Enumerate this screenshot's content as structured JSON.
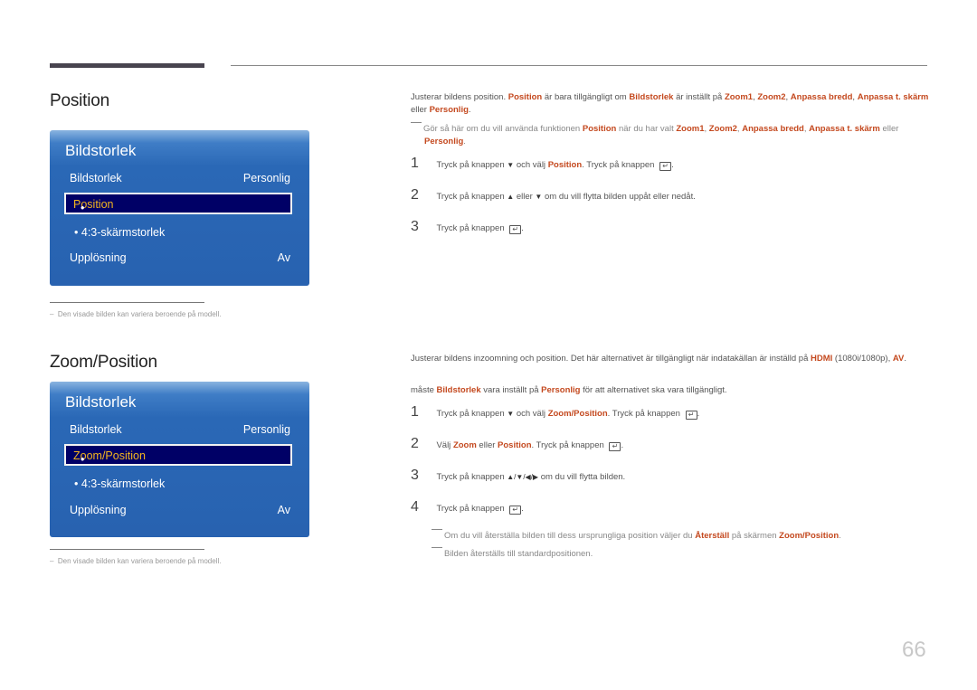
{
  "page_number": "66",
  "footnote": "Den visade bilden kan variera beroende på modell.",
  "section1": {
    "title": "Position",
    "menu": {
      "title": "Bildstorlek",
      "row1_label": "Bildstorlek",
      "row1_value": "Personlig",
      "selected_item": "Position",
      "sub_item": "4:3-skärmstorlek",
      "row3_label": "Upplösning",
      "row3_value": "Av",
      "bullet": "•"
    },
    "intro": {
      "t1": "Justerar bildens position. ",
      "h1": "Position",
      "t2": " är bara tillgängligt om ",
      "h2": "Bildstorlek",
      "t3": " är inställt på ",
      "h3": "Zoom1",
      "t4": ", ",
      "h4": "Zoom2",
      "t5": ", ",
      "h5": "Anpassa bredd",
      "t6": ", ",
      "h6": "Anpassa t. skärm",
      "t7": " eller ",
      "h7": "Personlig",
      "t8": "."
    },
    "note": {
      "t1": "Gör så här om du vill använda funktionen ",
      "h1": "Position",
      "t2": " när du har valt ",
      "h2": "Zoom1",
      "t3": ", ",
      "h3": "Zoom2",
      "t4": ", ",
      "h4": "Anpassa bredd",
      "t5": ", ",
      "h5": "Anpassa t. skärm",
      "t6": " eller ",
      "h6": "Personlig",
      "t7": "."
    },
    "steps": [
      {
        "num": "1",
        "t1": "Tryck på knappen ",
        "icon1": "▼",
        "t2": " och välj ",
        "h1": "Position",
        "t3": ". Tryck på knappen ",
        "enter": "↵",
        "t4": "."
      },
      {
        "num": "2",
        "t1": "Tryck på knappen ",
        "icon1": "▲",
        "t2": " eller ",
        "icon2": "▼",
        "t3": " om du vill flytta bilden uppåt eller nedåt."
      },
      {
        "num": "3",
        "t1": "Tryck på knappen ",
        "enter": "↵",
        "t2": "."
      }
    ]
  },
  "section2": {
    "title": "Zoom/Position",
    "menu": {
      "title": "Bildstorlek",
      "row1_label": "Bildstorlek",
      "row1_value": "Personlig",
      "selected_item": "Zoom/Position",
      "sub_item": "4:3-skärmstorlek",
      "row3_label": "Upplösning",
      "row3_value": "Av",
      "bullet": "•"
    },
    "intro": {
      "t1": "Justerar bildens inzoomning och position. Det här alternativet är tillgängligt när indatakällan är inställd på ",
      "h1": "HDMI",
      "t2": " (1080i/1080p), ",
      "h2": "AV",
      "t3": "."
    },
    "intro2": {
      "t1": "måste ",
      "h1": "Bildstorlek",
      "t2": " vara inställt på ",
      "h2": "Personlig",
      "t3": " för att alternativet ska vara tillgängligt."
    },
    "steps": [
      {
        "num": "1",
        "t1": "Tryck på knappen ",
        "icon1": "▼",
        "t2": " och välj ",
        "h1": "Zoom/Position",
        "t3": ". Tryck på knappen ",
        "enter": "↵",
        "t4": "."
      },
      {
        "num": "2",
        "t1": "Välj ",
        "h1": "Zoom",
        "t2": " eller ",
        "h2": "Position",
        "t3": ". Tryck på knappen ",
        "enter": "↵",
        "t4": "."
      },
      {
        "num": "3",
        "t1": "Tryck på knappen ",
        "icons": "▲/▼/◀/▶",
        "t2": " om du vill flytta bilden."
      },
      {
        "num": "4",
        "t1": "Tryck på knappen ",
        "enter": "↵",
        "t2": "."
      }
    ],
    "notes": [
      {
        "t1": "Om du vill återställa bilden till dess ursprungliga position väljer du ",
        "h1": "Återställ",
        "t2": " på skärmen ",
        "h2": "Zoom/Position",
        "t3": "."
      },
      {
        "t1": "Bilden återställs till standardpositionen."
      }
    ]
  }
}
